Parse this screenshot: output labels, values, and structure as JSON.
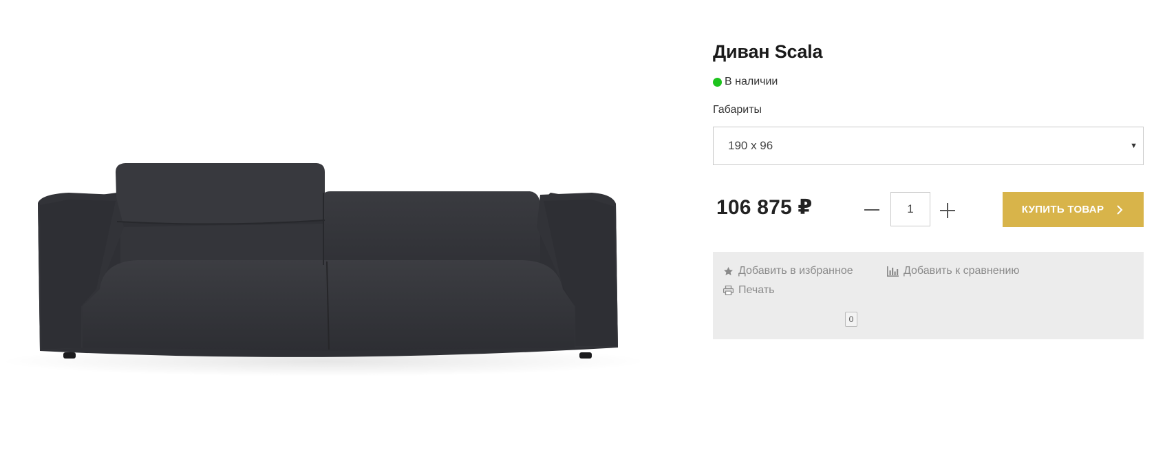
{
  "product": {
    "title": "Диван Scala",
    "stock": "В наличии",
    "stock_color": "#1ec31e",
    "image_icon": "sofa-image"
  },
  "dimensions": {
    "label": "Габариты",
    "selected": "190 x 96"
  },
  "purchase": {
    "price": "106 875 ₽",
    "quantity": "1",
    "buy_label": "КУПИТЬ ТОВАР",
    "accent_color": "#d8b44a"
  },
  "actions": {
    "favorite_label": "Добавить в избранное",
    "favorite_icon": "star-icon",
    "compare_label": "Добавить к сравнению",
    "compare_icon": "bar-chart-icon",
    "print_label": "Печать",
    "print_icon": "printer-icon",
    "counter": "0"
  }
}
